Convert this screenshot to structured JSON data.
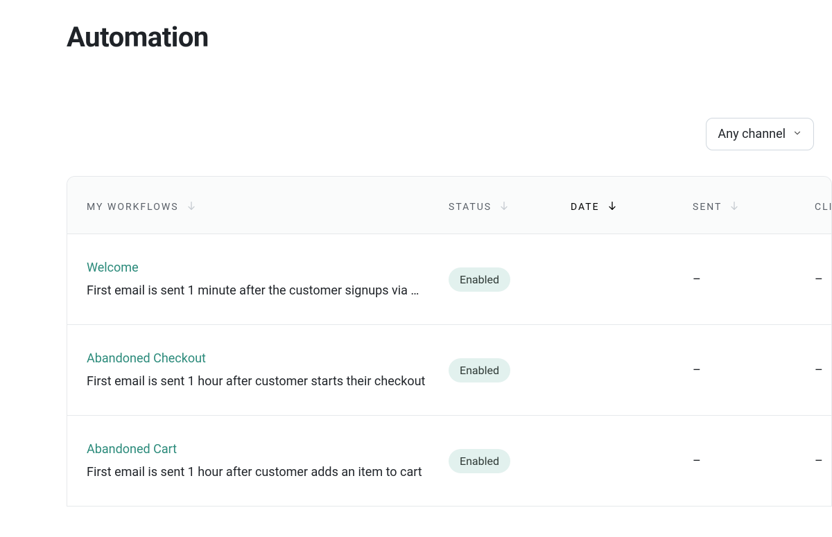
{
  "page": {
    "title": "Automation"
  },
  "filter": {
    "channel_label": "Any channel"
  },
  "table": {
    "headers": {
      "workflows": "My Workflows",
      "status": "Status",
      "date": "Date",
      "sent": "Sent",
      "click": "CLI"
    },
    "rows": [
      {
        "name": "Welcome",
        "description": "First email is sent 1 minute after the customer signups via …",
        "status": "Enabled",
        "date": "",
        "sent": "–",
        "click": "–"
      },
      {
        "name": "Abandoned Checkout",
        "description": "First email is sent 1 hour after customer starts their checkout",
        "status": "Enabled",
        "date": "",
        "sent": "–",
        "click": "–"
      },
      {
        "name": "Abandoned Cart",
        "description": "First email is sent 1 hour after customer adds an item to cart",
        "status": "Enabled",
        "date": "",
        "sent": "–",
        "click": "–"
      }
    ]
  }
}
